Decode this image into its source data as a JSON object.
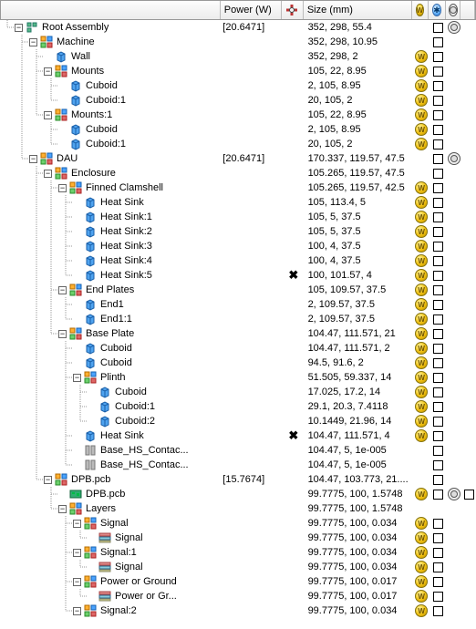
{
  "columns": {
    "name": "",
    "power": "Power (W)",
    "size": "Size (mm)"
  },
  "rows": [
    {
      "depth": 0,
      "exp": "-",
      "icon": "root",
      "label": "Root Assembly",
      "power": "[20.6471]",
      "size": "352, 298, 55.4",
      "w": false,
      "cb1": true,
      "s": true,
      "cb2": false
    },
    {
      "depth": 1,
      "exp": "-",
      "icon": "asm",
      "label": "Machine",
      "power": "",
      "size": "352, 298, 10.95",
      "w": false,
      "cb1": true,
      "s": false,
      "cb2": false
    },
    {
      "depth": 2,
      "exp": "",
      "icon": "box",
      "label": "Wall",
      "power": "",
      "size": "352, 298, 2",
      "w": true,
      "cb1": true,
      "s": false,
      "cb2": false
    },
    {
      "depth": 2,
      "exp": "-",
      "icon": "asm",
      "label": "Mounts",
      "power": "",
      "size": "105, 22, 8.95",
      "w": true,
      "cb1": true,
      "s": false,
      "cb2": false
    },
    {
      "depth": 3,
      "exp": "",
      "icon": "box",
      "label": "Cuboid",
      "power": "",
      "size": "2, 105, 8.95",
      "w": true,
      "cb1": true,
      "s": false,
      "cb2": false
    },
    {
      "depth": 3,
      "exp": "",
      "icon": "box",
      "label": "Cuboid:1",
      "power": "",
      "size": "20, 105, 2",
      "w": true,
      "cb1": true,
      "s": false,
      "cb2": false
    },
    {
      "depth": 2,
      "exp": "-",
      "icon": "asm",
      "label": "Mounts:1",
      "power": "",
      "size": "105, 22, 8.95",
      "w": true,
      "cb1": true,
      "s": false,
      "cb2": false
    },
    {
      "depth": 3,
      "exp": "",
      "icon": "box",
      "label": "Cuboid",
      "power": "",
      "size": "2, 105, 8.95",
      "w": true,
      "cb1": true,
      "s": false,
      "cb2": false
    },
    {
      "depth": 3,
      "exp": "",
      "icon": "box",
      "label": "Cuboid:1",
      "power": "",
      "size": "20, 105, 2",
      "w": true,
      "cb1": true,
      "s": false,
      "cb2": false
    },
    {
      "depth": 1,
      "exp": "-",
      "icon": "asm",
      "label": "DAU",
      "power": "[20.6471]",
      "size": "170.337, 119.57, 47.5",
      "w": false,
      "cb1": true,
      "s": true,
      "cb2": false
    },
    {
      "depth": 2,
      "exp": "-",
      "icon": "asm",
      "label": "Enclosure",
      "power": "",
      "size": "105.265, 119.57, 47.5",
      "w": false,
      "cb1": true,
      "s": false,
      "cb2": false
    },
    {
      "depth": 3,
      "exp": "-",
      "icon": "asm",
      "label": "Finned Clamshell",
      "power": "",
      "size": "105.265, 119.57, 42.5",
      "w": true,
      "cb1": true,
      "s": false,
      "cb2": false
    },
    {
      "depth": 4,
      "exp": "",
      "icon": "box",
      "label": "Heat Sink",
      "power": "",
      "size": "105, 113.4, 5",
      "w": true,
      "cb1": true,
      "s": false,
      "cb2": false
    },
    {
      "depth": 4,
      "exp": "",
      "icon": "box",
      "label": "Heat Sink:1",
      "power": "",
      "size": "105, 5, 37.5",
      "w": true,
      "cb1": true,
      "s": false,
      "cb2": false
    },
    {
      "depth": 4,
      "exp": "",
      "icon": "box",
      "label": "Heat Sink:2",
      "power": "",
      "size": "105, 5, 37.5",
      "w": true,
      "cb1": true,
      "s": false,
      "cb2": false
    },
    {
      "depth": 4,
      "exp": "",
      "icon": "box",
      "label": "Heat Sink:3",
      "power": "",
      "size": "100, 4, 37.5",
      "w": true,
      "cb1": true,
      "s": false,
      "cb2": false
    },
    {
      "depth": 4,
      "exp": "",
      "icon": "box",
      "label": "Heat Sink:4",
      "power": "",
      "size": "100, 4, 37.5",
      "w": true,
      "cb1": true,
      "s": false,
      "cb2": false
    },
    {
      "depth": 4,
      "exp": "",
      "icon": "box",
      "label": "Heat Sink:5",
      "power": "",
      "bug": true,
      "size": "100, 101.57, 4",
      "w": true,
      "cb1": true,
      "s": false,
      "cb2": false
    },
    {
      "depth": 3,
      "exp": "-",
      "icon": "asm",
      "label": "End Plates",
      "power": "",
      "size": "105, 109.57, 37.5",
      "w": true,
      "cb1": true,
      "s": false,
      "cb2": false
    },
    {
      "depth": 4,
      "exp": "",
      "icon": "box",
      "label": "End1",
      "power": "",
      "size": "2, 109.57, 37.5",
      "w": true,
      "cb1": true,
      "s": false,
      "cb2": false
    },
    {
      "depth": 4,
      "exp": "",
      "icon": "box",
      "label": "End1:1",
      "power": "",
      "size": "2, 109.57, 37.5",
      "w": true,
      "cb1": true,
      "s": false,
      "cb2": false
    },
    {
      "depth": 3,
      "exp": "-",
      "icon": "asm",
      "label": "Base Plate",
      "power": "",
      "size": "104.47, 111.571, 21",
      "w": true,
      "cb1": true,
      "s": false,
      "cb2": false
    },
    {
      "depth": 4,
      "exp": "",
      "icon": "box",
      "label": "Cuboid",
      "power": "",
      "size": "104.47, 111.571, 2",
      "w": true,
      "cb1": true,
      "s": false,
      "cb2": false
    },
    {
      "depth": 4,
      "exp": "",
      "icon": "box",
      "label": "Cuboid",
      "power": "",
      "size": "94.5, 91.6, 2",
      "w": true,
      "cb1": true,
      "s": false,
      "cb2": false
    },
    {
      "depth": 4,
      "exp": "-",
      "icon": "asm",
      "label": "Plinth",
      "power": "",
      "size": "51.505, 59.337, 14",
      "w": true,
      "cb1": true,
      "s": false,
      "cb2": false
    },
    {
      "depth": 5,
      "exp": "",
      "icon": "box",
      "label": "Cuboid",
      "power": "",
      "size": "17.025, 17.2, 14",
      "w": true,
      "cb1": true,
      "s": false,
      "cb2": false
    },
    {
      "depth": 5,
      "exp": "",
      "icon": "box",
      "label": "Cuboid:1",
      "power": "",
      "size": "29.1, 20.3, 7.4118",
      "w": true,
      "cb1": true,
      "s": false,
      "cb2": false
    },
    {
      "depth": 5,
      "exp": "",
      "icon": "box",
      "label": "Cuboid:2",
      "power": "",
      "size": "10.1449, 21.96, 14",
      "w": true,
      "cb1": true,
      "s": false,
      "cb2": false
    },
    {
      "depth": 4,
      "exp": "",
      "icon": "box",
      "label": "Heat Sink",
      "power": "",
      "bug": true,
      "size": "104.47, 111.571, 4",
      "w": true,
      "cb1": true,
      "s": false,
      "cb2": false
    },
    {
      "depth": 4,
      "exp": "",
      "icon": "contact",
      "label": "Base_HS_Contac...",
      "power": "",
      "size": "104.47, 5, 1e-005",
      "w": false,
      "cb1": true,
      "s": false,
      "cb2": false
    },
    {
      "depth": 4,
      "exp": "",
      "icon": "contact",
      "label": "Base_HS_Contac...",
      "power": "",
      "size": "104.47, 5, 1e-005",
      "w": false,
      "cb1": true,
      "s": false,
      "cb2": false
    },
    {
      "depth": 2,
      "exp": "-",
      "icon": "asm",
      "label": "DPB.pcb",
      "power": "[15.7674]",
      "size": "104.47, 103.773, 21....",
      "w": false,
      "cb1": true,
      "s": false,
      "cb2": false
    },
    {
      "depth": 3,
      "exp": "",
      "icon": "pcb",
      "label": "DPB.pcb",
      "power": "",
      "size": "99.7775, 100, 1.5748",
      "w": true,
      "cb1": true,
      "s": true,
      "cb2": true
    },
    {
      "depth": 3,
      "exp": "-",
      "icon": "asm",
      "label": "Layers",
      "power": "",
      "size": "99.7775, 100, 1.5748",
      "w": false,
      "cb1": false,
      "s": false,
      "cb2": false
    },
    {
      "depth": 4,
      "exp": "-",
      "icon": "asm",
      "label": "Signal",
      "power": "",
      "size": "99.7775, 100, 0.034",
      "w": true,
      "cb1": true,
      "s": false,
      "cb2": false
    },
    {
      "depth": 5,
      "exp": "",
      "icon": "layer",
      "label": "Signal",
      "power": "",
      "size": "99.7775, 100, 0.034",
      "w": true,
      "cb1": true,
      "s": false,
      "cb2": false
    },
    {
      "depth": 4,
      "exp": "-",
      "icon": "asm",
      "label": "Signal:1",
      "power": "",
      "size": "99.7775, 100, 0.034",
      "w": true,
      "cb1": true,
      "s": false,
      "cb2": false
    },
    {
      "depth": 5,
      "exp": "",
      "icon": "layer",
      "label": "Signal",
      "power": "",
      "size": "99.7775, 100, 0.034",
      "w": true,
      "cb1": true,
      "s": false,
      "cb2": false
    },
    {
      "depth": 4,
      "exp": "-",
      "icon": "asm",
      "label": "Power or Ground",
      "power": "",
      "size": "99.7775, 100, 0.017",
      "w": true,
      "cb1": true,
      "s": false,
      "cb2": false
    },
    {
      "depth": 5,
      "exp": "",
      "icon": "layer",
      "label": "Power or Gr...",
      "power": "",
      "size": "99.7775, 100, 0.017",
      "w": true,
      "cb1": true,
      "s": false,
      "cb2": false
    },
    {
      "depth": 4,
      "exp": "-",
      "icon": "asm",
      "label": "Signal:2",
      "power": "",
      "size": "99.7775, 100, 0.034",
      "w": true,
      "cb1": true,
      "s": false,
      "cb2": false
    }
  ]
}
